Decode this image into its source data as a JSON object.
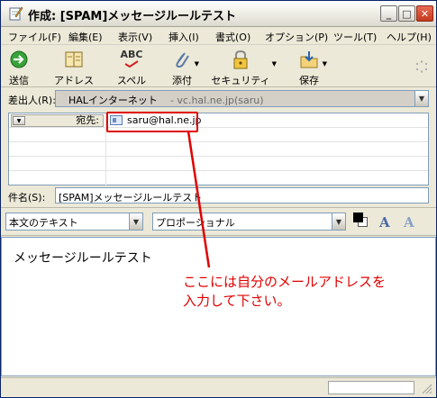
{
  "window": {
    "title": "作成: [SPAM]メッセージルールテスト"
  },
  "titlebar_buttons": {
    "minimize": "_",
    "maximize": "□",
    "close": "✕"
  },
  "menu": [
    "ファイル(F)",
    "編集(E)",
    "表示(V)",
    "挿入(I)",
    "書式(O)",
    "オプション(P)",
    "ツール(T)",
    "ヘルプ(H)"
  ],
  "toolbar": {
    "send": "送信",
    "address": "アドレス",
    "spell": "スペル",
    "spell_icon_text": "ABC",
    "attach": "添付",
    "security": "セキュリティ",
    "save": "保存"
  },
  "from": {
    "label": "差出人(R):",
    "identity": "HALインターネット",
    "account": "- vc.hal.ne.jp(saru)"
  },
  "recipients": [
    {
      "type": "宛先:",
      "address": "saru@hal.ne.jp"
    }
  ],
  "subject": {
    "label": "件名(S):",
    "value": "[SPAM]メッセージルールテスト"
  },
  "format": {
    "mode": "本文のテキスト",
    "font": "プロポーショナル",
    "font_btn_larger": "A",
    "font_btn_smaller": "A"
  },
  "body": {
    "text": "メッセージルールテスト"
  },
  "annotation": {
    "line1": "ここには自分のメールアドレスを",
    "line2": "入力して下さい。"
  },
  "colors": {
    "annotation": "#e00000",
    "accent": "#7f9db9"
  },
  "icons": [
    "edit-icon",
    "send-icon",
    "address-book-icon",
    "spell-check-icon",
    "paperclip-icon",
    "lock-icon",
    "save-icon",
    "throbber-icon",
    "contact-card-icon",
    "chevron-down-icon",
    "resize-grip-icon"
  ]
}
